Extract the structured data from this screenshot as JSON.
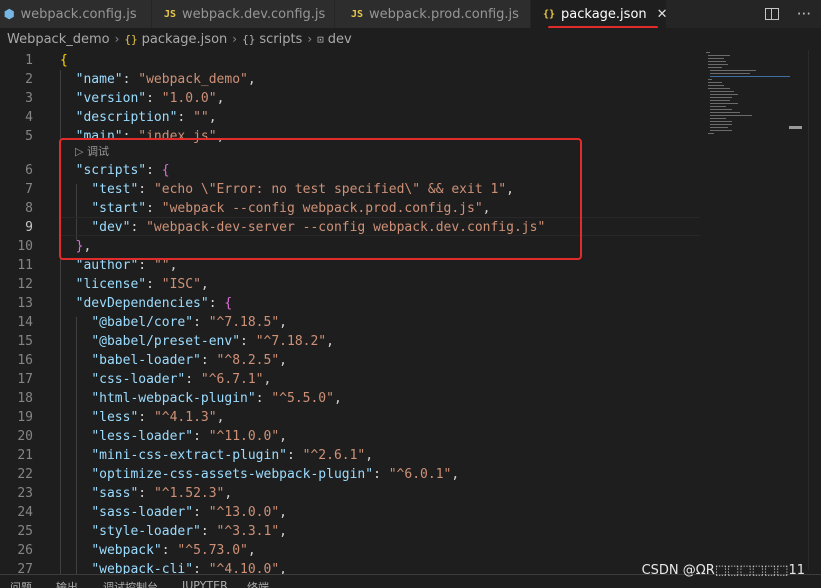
{
  "tabs": [
    {
      "icon": "webpack-icon",
      "label": "webpack.config.js",
      "active": false
    },
    {
      "icon": "js-icon",
      "icon_text": "JS",
      "label": "webpack.dev.config.js",
      "active": false
    },
    {
      "icon": "js-icon",
      "icon_text": "JS",
      "label": "webpack.prod.config.js",
      "active": false
    },
    {
      "icon": "json-icon",
      "icon_text": "{}",
      "label": "package.json",
      "active": true,
      "close": "✕"
    }
  ],
  "breadcrumb": [
    {
      "label": "Webpack_demo"
    },
    {
      "icon_text": "{}",
      "label": "package.json"
    },
    {
      "icon_text": "{}",
      "label": "scripts"
    },
    {
      "icon_text": "⊡",
      "label": "dev"
    }
  ],
  "breadcrumb_sep": "›",
  "codelens": "▷ 调试",
  "lines": [
    {
      "n": "1"
    },
    {
      "n": "2"
    },
    {
      "n": "3"
    },
    {
      "n": "4"
    },
    {
      "n": "5"
    },
    {
      "n": "6"
    },
    {
      "n": "7"
    },
    {
      "n": "8"
    },
    {
      "n": "9"
    },
    {
      "n": "10"
    },
    {
      "n": "11"
    },
    {
      "n": "12"
    },
    {
      "n": "13"
    },
    {
      "n": "14"
    },
    {
      "n": "15"
    },
    {
      "n": "16"
    },
    {
      "n": "17"
    },
    {
      "n": "18"
    },
    {
      "n": "19"
    },
    {
      "n": "20"
    },
    {
      "n": "21"
    },
    {
      "n": "22"
    },
    {
      "n": "23"
    },
    {
      "n": "24"
    },
    {
      "n": "25"
    },
    {
      "n": "26"
    },
    {
      "n": "27"
    }
  ],
  "code": {
    "name_key": "\"name\"",
    "name_val": "\"webpack_demo\"",
    "version_key": "\"version\"",
    "version_val": "\"1.0.0\"",
    "description_key": "\"description\"",
    "description_val": "\"\"",
    "main_key": "\"main\"",
    "main_val": "\"index.js\"",
    "scripts_key": "\"scripts\"",
    "test_key": "\"test\"",
    "test_val": "\"echo \\\"Error: no test specified\\\" && exit 1\"",
    "start_key": "\"start\"",
    "start_val": "\"webpack --config webpack.prod.config.js\"",
    "dev_key": "\"dev\"",
    "dev_val": "\"webpack-dev-server --config webpack.dev.config.js\"",
    "author_key": "\"author\"",
    "author_val": "\"\"",
    "license_key": "\"license\"",
    "license_val": "\"ISC\"",
    "devdeps_key": "\"devDependencies\""
  },
  "deps": [
    {
      "k": "\"@babel/core\"",
      "v": "\"^7.18.5\""
    },
    {
      "k": "\"@babel/preset-env\"",
      "v": "\"^7.18.2\""
    },
    {
      "k": "\"babel-loader\"",
      "v": "\"^8.2.5\""
    },
    {
      "k": "\"css-loader\"",
      "v": "\"^6.7.1\""
    },
    {
      "k": "\"html-webpack-plugin\"",
      "v": "\"^5.5.0\""
    },
    {
      "k": "\"less\"",
      "v": "\"^4.1.3\""
    },
    {
      "k": "\"less-loader\"",
      "v": "\"^11.0.0\""
    },
    {
      "k": "\"mini-css-extract-plugin\"",
      "v": "\"^2.6.1\""
    },
    {
      "k": "\"optimize-css-assets-webpack-plugin\"",
      "v": "\"^6.0.1\""
    },
    {
      "k": "\"sass\"",
      "v": "\"^1.52.3\""
    },
    {
      "k": "\"sass-loader\"",
      "v": "\"^13.0.0\""
    },
    {
      "k": "\"style-loader\"",
      "v": "\"^3.3.1\""
    },
    {
      "k": "\"webpack\"",
      "v": "\"^5.73.0\""
    },
    {
      "k": "\"webpack-cli\"",
      "v": "\"^4.10.0\""
    }
  ],
  "panel_tabs": [
    "问题",
    "输出",
    "调试控制台",
    "JUPYTER",
    "终端"
  ],
  "watermark": "CSDN @\u0000R\u0000\u0000\u0000\u0000\u0000\u000011",
  "watermark_text": "CSDN @ΩR⬚⬚⬚⬚⬚⬚11",
  "colors": {
    "accent_red": "#e22b2b",
    "bg": "#1e1e1e",
    "key": "#9cdcfe",
    "string": "#ce9178"
  }
}
